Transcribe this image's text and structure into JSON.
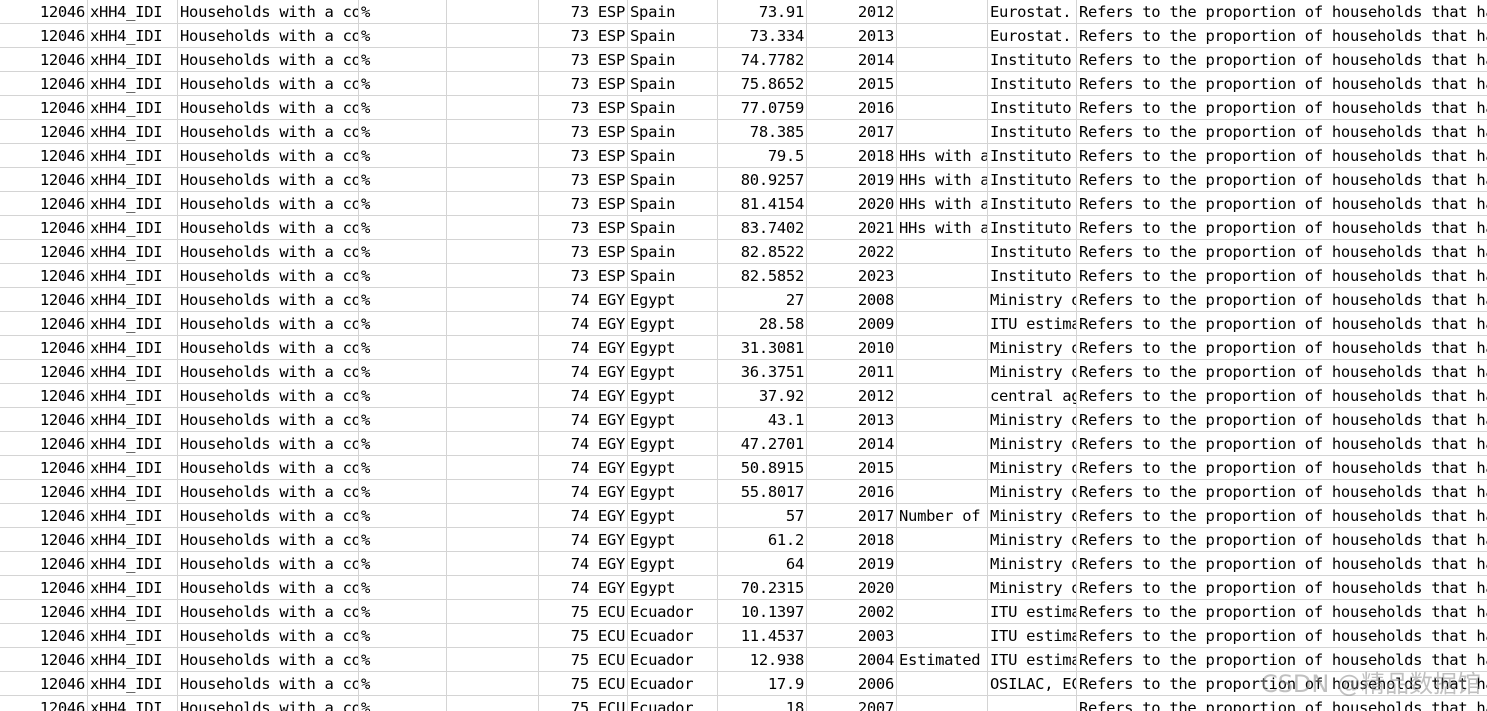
{
  "rows": [
    {
      "c0": "12046",
      "c1": "xHH4_IDI",
      "c2": "Households with a co",
      "c3": "%",
      "c4": "",
      "c5": "73 ESP",
      "c6": "Spain",
      "c7": "73.91",
      "c8": "2012",
      "c9": "",
      "c10": "Eurostat.",
      "c11": "Refers to the proportion of households that ha"
    },
    {
      "c0": "12046",
      "c1": "xHH4_IDI",
      "c2": "Households with a co",
      "c3": "%",
      "c4": "",
      "c5": "73 ESP",
      "c6": "Spain",
      "c7": "73.334",
      "c8": "2013",
      "c9": "",
      "c10": "Eurostat.",
      "c11": "Refers to the proportion of households that ha"
    },
    {
      "c0": "12046",
      "c1": "xHH4_IDI",
      "c2": "Households with a co",
      "c3": "%",
      "c4": "",
      "c5": "73 ESP",
      "c6": "Spain",
      "c7": "74.7782",
      "c8": "2014",
      "c9": "",
      "c10": "Instituto",
      "c11": "Refers to the proportion of households that ha"
    },
    {
      "c0": "12046",
      "c1": "xHH4_IDI",
      "c2": "Households with a co",
      "c3": "%",
      "c4": "",
      "c5": "73 ESP",
      "c6": "Spain",
      "c7": "75.8652",
      "c8": "2015",
      "c9": "",
      "c10": "Instituto",
      "c11": "Refers to the proportion of households that ha"
    },
    {
      "c0": "12046",
      "c1": "xHH4_IDI",
      "c2": "Households with a co",
      "c3": "%",
      "c4": "",
      "c5": "73 ESP",
      "c6": "Spain",
      "c7": "77.0759",
      "c8": "2016",
      "c9": "",
      "c10": "Instituto",
      "c11": "Refers to the proportion of households that ha"
    },
    {
      "c0": "12046",
      "c1": "xHH4_IDI",
      "c2": "Households with a co",
      "c3": "%",
      "c4": "",
      "c5": "73 ESP",
      "c6": "Spain",
      "c7": "78.385",
      "c8": "2017",
      "c9": "",
      "c10": "Instituto",
      "c11": "Refers to the proportion of households that ha"
    },
    {
      "c0": "12046",
      "c1": "xHH4_IDI",
      "c2": "Households with a co",
      "c3": "%",
      "c4": "",
      "c5": "73 ESP",
      "c6": "Spain",
      "c7": "79.5",
      "c8": "2018",
      "c9": "HHs with a",
      "c10": "Instituto",
      "c11": "Refers to the proportion of households that ha"
    },
    {
      "c0": "12046",
      "c1": "xHH4_IDI",
      "c2": "Households with a co",
      "c3": "%",
      "c4": "",
      "c5": "73 ESP",
      "c6": "Spain",
      "c7": "80.9257",
      "c8": "2019",
      "c9": "HHs with a",
      "c10": "Instituto",
      "c11": "Refers to the proportion of households that ha"
    },
    {
      "c0": "12046",
      "c1": "xHH4_IDI",
      "c2": "Households with a co",
      "c3": "%",
      "c4": "",
      "c5": "73 ESP",
      "c6": "Spain",
      "c7": "81.4154",
      "c8": "2020",
      "c9": "HHs with a",
      "c10": "Instituto",
      "c11": "Refers to the proportion of households that ha"
    },
    {
      "c0": "12046",
      "c1": "xHH4_IDI",
      "c2": "Households with a co",
      "c3": "%",
      "c4": "",
      "c5": "73 ESP",
      "c6": "Spain",
      "c7": "83.7402",
      "c8": "2021",
      "c9": "HHs with a",
      "c10": "Instituto",
      "c11": "Refers to the proportion of households that ha"
    },
    {
      "c0": "12046",
      "c1": "xHH4_IDI",
      "c2": "Households with a co",
      "c3": "%",
      "c4": "",
      "c5": "73 ESP",
      "c6": "Spain",
      "c7": "82.8522",
      "c8": "2022",
      "c9": "",
      "c10": "Instituto",
      "c11": "Refers to the proportion of households that ha"
    },
    {
      "c0": "12046",
      "c1": "xHH4_IDI",
      "c2": "Households with a co",
      "c3": "%",
      "c4": "",
      "c5": "73 ESP",
      "c6": "Spain",
      "c7": "82.5852",
      "c8": "2023",
      "c9": "",
      "c10": "Instituto",
      "c11": "Refers to the proportion of households that ha"
    },
    {
      "c0": "12046",
      "c1": "xHH4_IDI",
      "c2": "Households with a co",
      "c3": "%",
      "c4": "",
      "c5": "74 EGY",
      "c6": "Egypt",
      "c7": "27",
      "c8": "2008",
      "c9": "",
      "c10": "Ministry o",
      "c11": "Refers to the proportion of households that ha"
    },
    {
      "c0": "12046",
      "c1": "xHH4_IDI",
      "c2": "Households with a co",
      "c3": "%",
      "c4": "",
      "c5": "74 EGY",
      "c6": "Egypt",
      "c7": "28.58",
      "c8": "2009",
      "c9": "",
      "c10": "ITU estima",
      "c11": "Refers to the proportion of households that ha"
    },
    {
      "c0": "12046",
      "c1": "xHH4_IDI",
      "c2": "Households with a co",
      "c3": "%",
      "c4": "",
      "c5": "74 EGY",
      "c6": "Egypt",
      "c7": "31.3081",
      "c8": "2010",
      "c9": "",
      "c10": "Ministry o",
      "c11": "Refers to the proportion of households that ha"
    },
    {
      "c0": "12046",
      "c1": "xHH4_IDI",
      "c2": "Households with a co",
      "c3": "%",
      "c4": "",
      "c5": "74 EGY",
      "c6": "Egypt",
      "c7": "36.3751",
      "c8": "2011",
      "c9": "",
      "c10": "Ministry o",
      "c11": "Refers to the proportion of households that ha"
    },
    {
      "c0": "12046",
      "c1": "xHH4_IDI",
      "c2": "Households with a co",
      "c3": "%",
      "c4": "",
      "c5": "74 EGY",
      "c6": "Egypt",
      "c7": "37.92",
      "c8": "2012",
      "c9": "",
      "c10": "central ag",
      "c11": "Refers to the proportion of households that ha"
    },
    {
      "c0": "12046",
      "c1": "xHH4_IDI",
      "c2": "Households with a co",
      "c3": "%",
      "c4": "",
      "c5": "74 EGY",
      "c6": "Egypt",
      "c7": "43.1",
      "c8": "2013",
      "c9": "",
      "c10": "Ministry o",
      "c11": "Refers to the proportion of households that ha"
    },
    {
      "c0": "12046",
      "c1": "xHH4_IDI",
      "c2": "Households with a co",
      "c3": "%",
      "c4": "",
      "c5": "74 EGY",
      "c6": "Egypt",
      "c7": "47.2701",
      "c8": "2014",
      "c9": "",
      "c10": "Ministry o",
      "c11": "Refers to the proportion of households that ha"
    },
    {
      "c0": "12046",
      "c1": "xHH4_IDI",
      "c2": "Households with a co",
      "c3": "%",
      "c4": "",
      "c5": "74 EGY",
      "c6": "Egypt",
      "c7": "50.8915",
      "c8": "2015",
      "c9": "",
      "c10": "Ministry o",
      "c11": "Refers to the proportion of households that ha"
    },
    {
      "c0": "12046",
      "c1": "xHH4_IDI",
      "c2": "Households with a co",
      "c3": "%",
      "c4": "",
      "c5": "74 EGY",
      "c6": "Egypt",
      "c7": "55.8017",
      "c8": "2016",
      "c9": "",
      "c10": "Ministry o",
      "c11": "Refers to the proportion of households that ha"
    },
    {
      "c0": "12046",
      "c1": "xHH4_IDI",
      "c2": "Households with a co",
      "c3": "%",
      "c4": "",
      "c5": "74 EGY",
      "c6": "Egypt",
      "c7": "57",
      "c8": "2017",
      "c9": "Number of",
      "c10": "Ministry o",
      "c11": "Refers to the proportion of households that ha"
    },
    {
      "c0": "12046",
      "c1": "xHH4_IDI",
      "c2": "Households with a co",
      "c3": "%",
      "c4": "",
      "c5": "74 EGY",
      "c6": "Egypt",
      "c7": "61.2",
      "c8": "2018",
      "c9": "",
      "c10": "Ministry o",
      "c11": "Refers to the proportion of households that ha"
    },
    {
      "c0": "12046",
      "c1": "xHH4_IDI",
      "c2": "Households with a co",
      "c3": "%",
      "c4": "",
      "c5": "74 EGY",
      "c6": "Egypt",
      "c7": "64",
      "c8": "2019",
      "c9": "",
      "c10": "Ministry o",
      "c11": "Refers to the proportion of households that ha"
    },
    {
      "c0": "12046",
      "c1": "xHH4_IDI",
      "c2": "Households with a co",
      "c3": "%",
      "c4": "",
      "c5": "74 EGY",
      "c6": "Egypt",
      "c7": "70.2315",
      "c8": "2020",
      "c9": "",
      "c10": "Ministry o",
      "c11": "Refers to the proportion of households that ha"
    },
    {
      "c0": "12046",
      "c1": "xHH4_IDI",
      "c2": "Households with a co",
      "c3": "%",
      "c4": "",
      "c5": "75 ECU",
      "c6": "Ecuador",
      "c7": "10.1397",
      "c8": "2002",
      "c9": "",
      "c10": "ITU estima",
      "c11": "Refers to the proportion of households that ha"
    },
    {
      "c0": "12046",
      "c1": "xHH4_IDI",
      "c2": "Households with a co",
      "c3": "%",
      "c4": "",
      "c5": "75 ECU",
      "c6": "Ecuador",
      "c7": "11.4537",
      "c8": "2003",
      "c9": "",
      "c10": "ITU estima",
      "c11": "Refers to the proportion of households that ha"
    },
    {
      "c0": "12046",
      "c1": "xHH4_IDI",
      "c2": "Households with a co",
      "c3": "%",
      "c4": "",
      "c5": "75 ECU",
      "c6": "Ecuador",
      "c7": "12.938",
      "c8": "2004",
      "c9": "Estimated",
      "c10": "ITU estima",
      "c11": "Refers to the proportion of households that ha"
    },
    {
      "c0": "12046",
      "c1": "xHH4_IDI",
      "c2": "Households with a co",
      "c3": "%",
      "c4": "",
      "c5": "75 ECU",
      "c6": "Ecuador",
      "c7": "17.9",
      "c8": "2006",
      "c9": "",
      "c10": "OSILAC, EC",
      "c11": "Refers to the proportion of households that ha"
    },
    {
      "c0": "12046",
      "c1": "xHH4_IDI",
      "c2": "Households with a co",
      "c3": "%",
      "c4": "",
      "c5": "75 ECU",
      "c6": "Ecuador",
      "c7": "18",
      "c8": "2007",
      "c9": "",
      "c10": "",
      "c11": "Refers to the proportion of households that ha"
    }
  ],
  "watermark": "CSDN @精品数据馆"
}
